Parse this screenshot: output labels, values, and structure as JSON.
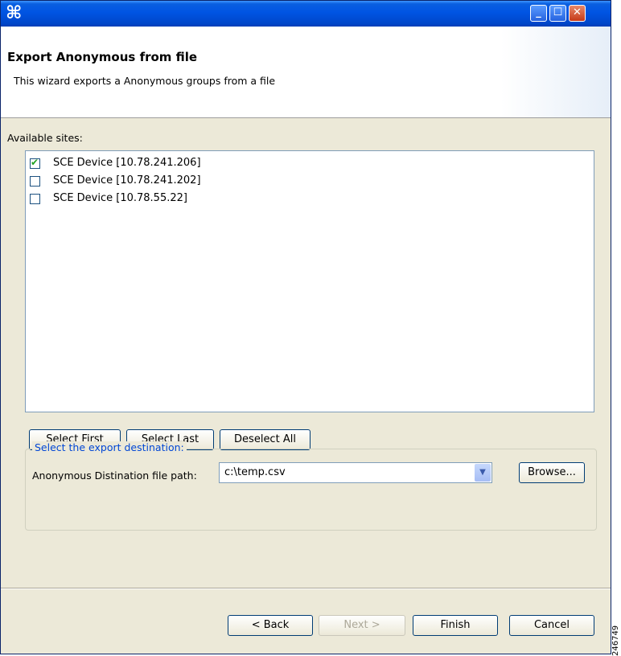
{
  "window": {
    "title_icon": "wizard-icon"
  },
  "header": {
    "title": "Export Anonymous from file",
    "description": "This wizard exports a Anonymous groups from a file"
  },
  "sites": {
    "label": "Available sites:",
    "items": [
      {
        "label": "SCE Device [10.78.241.206]",
        "checked": true
      },
      {
        "label": "SCE Device [10.78.241.202]",
        "checked": false
      },
      {
        "label": "SCE Device [10.78.55.22]",
        "checked": false
      }
    ]
  },
  "selection_buttons": {
    "select_first": "Select First",
    "select_last": "Select Last",
    "deselect_all": "Deselect All"
  },
  "destination": {
    "group_label": "Select the export destination:",
    "field_label": "Anonymous Distination file path:",
    "value": "c:\\temp.csv",
    "browse": "Browse..."
  },
  "footer": {
    "back": "< Back",
    "next": "Next >",
    "finish": "Finish",
    "cancel": "Cancel"
  },
  "watermark": "246749",
  "colors": {
    "titlebar": "#0054e3",
    "group_label": "#0046d5"
  }
}
